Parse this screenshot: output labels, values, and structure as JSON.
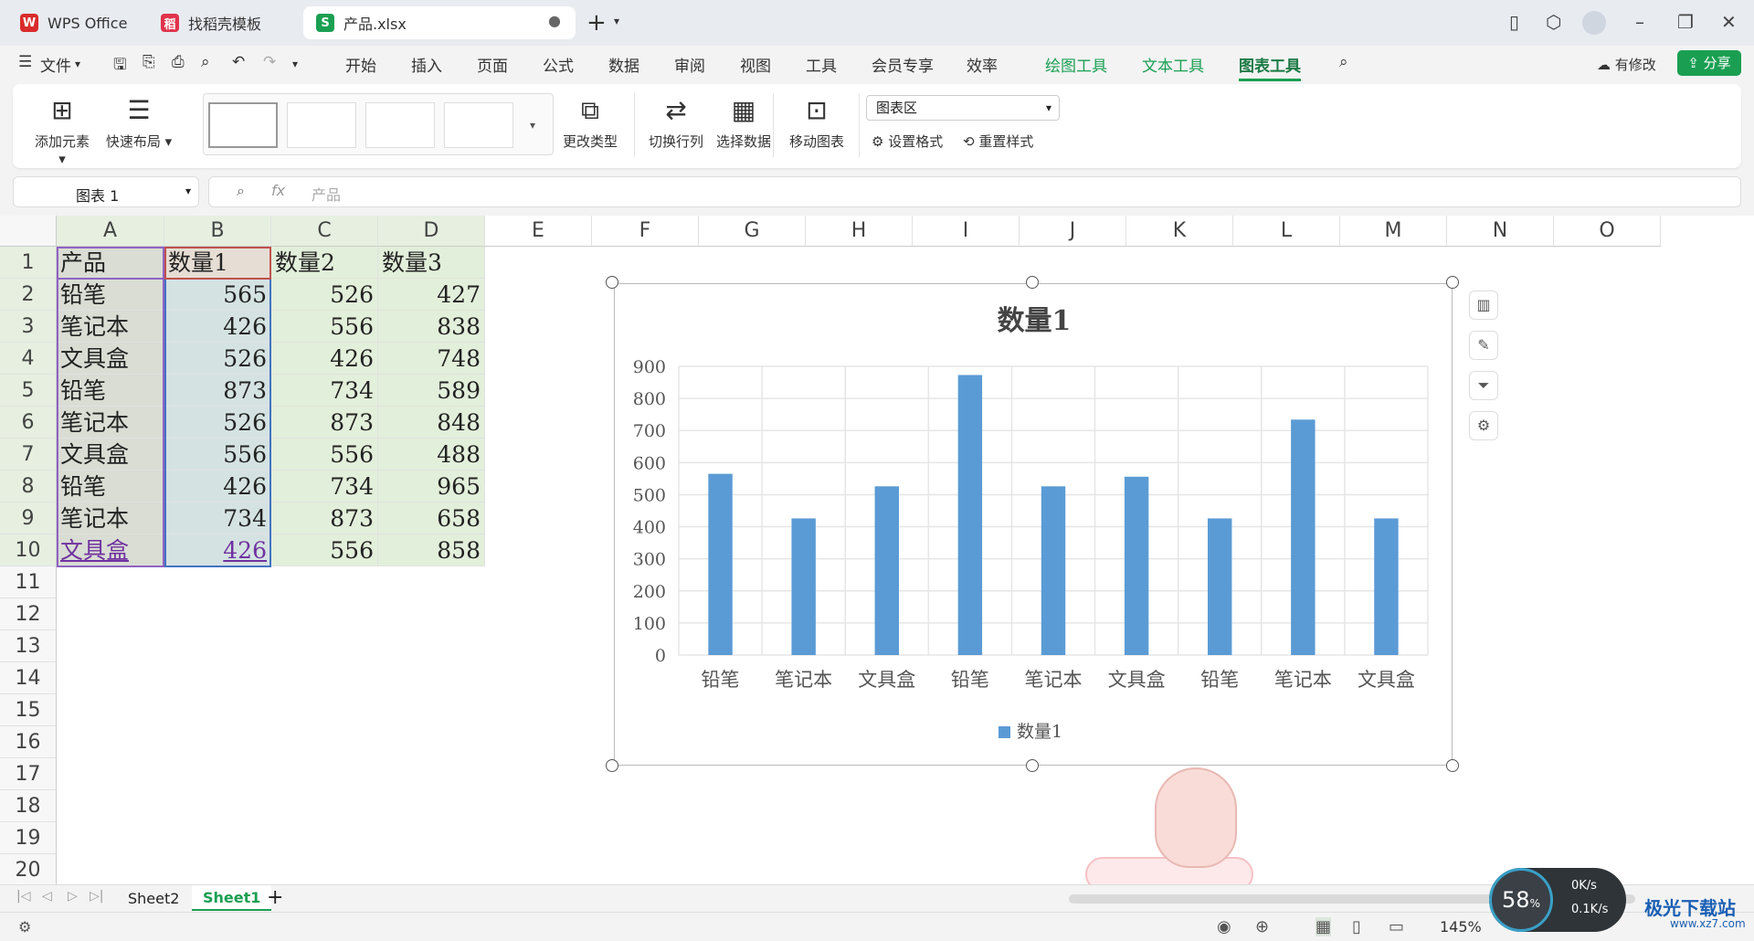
{
  "tabs": [
    {
      "label": "WPS Office",
      "logo": "W",
      "color": "#d92b2b"
    },
    {
      "label": "找稻壳模板",
      "logo": "稻",
      "color": "#e0334c"
    },
    {
      "label": "产品.xlsx",
      "logo": "S",
      "color": "#1a9f52"
    }
  ],
  "new_tab_icon": "plus-icon",
  "menu": {
    "file": "文件",
    "items": [
      "开始",
      "插入",
      "页面",
      "公式",
      "数据",
      "审阅",
      "视图",
      "工具",
      "会员专享",
      "效率"
    ],
    "context_items": [
      "绘图工具",
      "文本工具",
      "图表工具"
    ],
    "active": "图表工具",
    "modify": "有修改",
    "share": "分享"
  },
  "ribbon": {
    "add_element": "添加元素",
    "quick_layout": "快速布局",
    "change_type": "更改类型",
    "switch_rowcol": "切换行列",
    "select_data": "选择数据",
    "move_chart": "移动图表",
    "area_select": "图表区",
    "set_format": "设置格式",
    "reset_style": "重置样式"
  },
  "formula": {
    "namebox": "图表 1",
    "fx": "fx",
    "content": "产品"
  },
  "columns": [
    "A",
    "B",
    "C",
    "D",
    "E",
    "F",
    "G",
    "H",
    "I",
    "J",
    "K",
    "L",
    "M",
    "N",
    "O"
  ],
  "rows": [
    "1",
    "2",
    "3",
    "4",
    "5",
    "6",
    "7",
    "8",
    "9",
    "10",
    "11",
    "12",
    "13",
    "14",
    "15",
    "16",
    "17",
    "18",
    "19",
    "20"
  ],
  "table": {
    "headers": [
      "产品",
      "数量1",
      "数量2",
      "数量3"
    ],
    "data": [
      [
        "铅笔",
        "565",
        "526",
        "427"
      ],
      [
        "笔记本",
        "426",
        "556",
        "838"
      ],
      [
        "文具盒",
        "526",
        "426",
        "748"
      ],
      [
        "铅笔",
        "873",
        "734",
        "589"
      ],
      [
        "笔记本",
        "526",
        "873",
        "848"
      ],
      [
        "文具盒",
        "556",
        "556",
        "488"
      ],
      [
        "铅笔",
        "426",
        "734",
        "965"
      ],
      [
        "笔记本",
        "734",
        "873",
        "658"
      ],
      [
        "文具盒",
        "426",
        "556",
        "858"
      ]
    ]
  },
  "chart_data": {
    "type": "bar",
    "title": "数量1",
    "categories": [
      "铅笔",
      "笔记本",
      "文具盒",
      "铅笔",
      "笔记本",
      "文具盒",
      "铅笔",
      "笔记本",
      "文具盒"
    ],
    "series": [
      {
        "name": "数量1",
        "values": [
          565,
          426,
          526,
          873,
          526,
          556,
          426,
          734,
          426
        ],
        "color": "#5b9bd5"
      }
    ],
    "yticks": [
      "0",
      "100",
      "200",
      "300",
      "400",
      "500",
      "600",
      "700",
      "800",
      "900"
    ],
    "ylim": [
      0,
      900
    ],
    "grid": true,
    "legend": "bottom"
  },
  "sheets": [
    "Sheet2",
    "Sheet1"
  ],
  "active_sheet": "Sheet1",
  "status": {
    "zoom": "145%",
    "speed_pct": "58",
    "up": "0K/s",
    "down": "0.1K/s",
    "watermark": "极光下载站",
    "watermark_url": "www.xz7.com"
  }
}
